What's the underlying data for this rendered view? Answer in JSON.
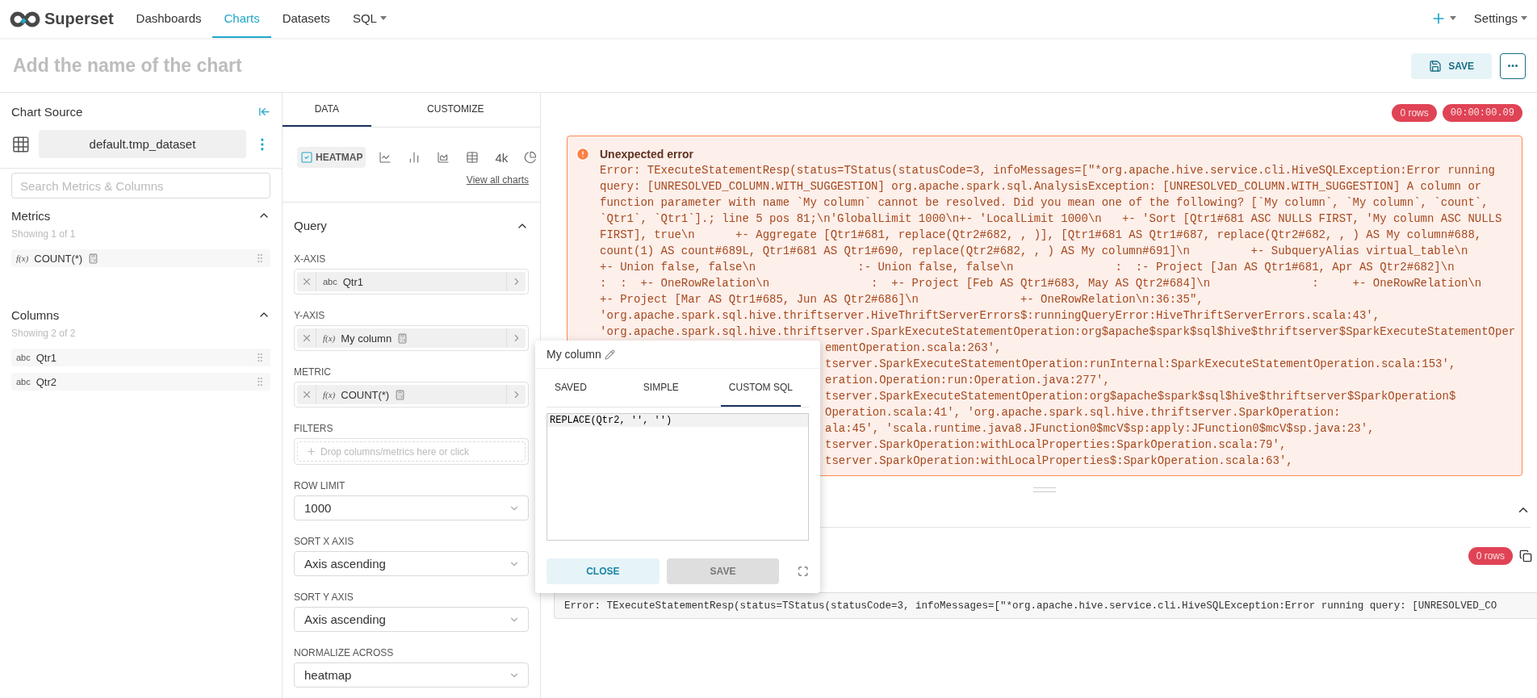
{
  "nav": {
    "logo": "Superset",
    "items": [
      {
        "label": "Dashboards",
        "selected": false,
        "dropdown": false
      },
      {
        "label": "Charts",
        "selected": true,
        "dropdown": false
      },
      {
        "label": "Datasets",
        "selected": false,
        "dropdown": false
      },
      {
        "label": "SQL",
        "selected": false,
        "dropdown": true
      }
    ],
    "settings": {
      "label": "Settings",
      "dropdown": true
    }
  },
  "chart_title": {
    "placeholder": "Add the name of the chart"
  },
  "save_button": {
    "label": "SAVE"
  },
  "chart_source": {
    "title": "Chart Source",
    "dataset": "default.tmp_dataset",
    "search": {
      "placeholder": "Search Metrics & Columns"
    },
    "sections": [
      {
        "title": "Metrics",
        "expanded": true,
        "showing": "Showing 1 of 1",
        "items": [
          {
            "kind": "metric",
            "type_label": "f(x)",
            "label": "COUNT(*)"
          }
        ]
      },
      {
        "title": "Columns",
        "expanded": true,
        "showing": "Showing 2 of 2",
        "items": [
          {
            "kind": "column",
            "type_label": "abc",
            "label": "Qtr1"
          },
          {
            "kind": "column",
            "type_label": "abc",
            "label": "Qtr2"
          }
        ]
      }
    ]
  },
  "tabs": [
    {
      "label": "DATA",
      "selected": true
    },
    {
      "label": "CUSTOMIZE",
      "selected": false
    }
  ],
  "chart_types": [
    {
      "kind": "heatmap",
      "label": "HEATMAP",
      "selected": true
    },
    {
      "kind": "line",
      "selected": false
    },
    {
      "kind": "bar",
      "selected": false
    },
    {
      "kind": "area",
      "selected": false
    },
    {
      "kind": "table",
      "selected": false
    },
    {
      "kind": "number",
      "label": "4k",
      "selected": false
    },
    {
      "kind": "pie",
      "selected": false
    }
  ],
  "view_all": "View all charts",
  "query": {
    "title": "Query",
    "expanded": true,
    "controls": [
      {
        "kind": "pill",
        "label": "X-AXIS",
        "type_label": "abc",
        "value": "Qtr1",
        "saved_metric": false
      },
      {
        "kind": "pill",
        "label": "Y-AXIS",
        "type_label": "f(x)",
        "value": "My column",
        "saved_metric": true
      },
      {
        "kind": "pill",
        "label": "METRIC",
        "type_label": "f(x)",
        "value": "COUNT(*)",
        "saved_metric": true
      },
      {
        "kind": "drop",
        "label": "FILTERS",
        "placeholder": "Drop columns/metrics here or click"
      },
      {
        "kind": "select",
        "label": "ROW LIMIT",
        "value": "1000"
      },
      {
        "kind": "select",
        "label": "SORT X AXIS",
        "value": "Axis ascending"
      },
      {
        "kind": "select",
        "label": "SORT Y AXIS",
        "value": "Axis ascending"
      },
      {
        "kind": "select",
        "label": "NORMALIZE ACROSS",
        "value": "heatmap"
      }
    ]
  },
  "results": {
    "badges": [
      {
        "kind": "rows",
        "text": "0 rows"
      },
      {
        "kind": "time",
        "text": "00:00:00.09"
      }
    ],
    "error": {
      "title": "Unexpected error",
      "lines": [
        {
          "text": "Error: TExecuteStatementResp(status=TStatus(statusCode=3, infoMessages=[\"*org.apache.hive.service.cli.HiveSQLException:Error running",
          "covered": false
        },
        {
          "text": "query: [UNRESOLVED_COLUMN.WITH_SUGGESTION] org.apache.spark.sql.AnalysisException: [UNRESOLVED_COLUMN.WITH_SUGGESTION] A column or",
          "covered": false
        },
        {
          "text": "function parameter with name `My column` cannot be resolved. Did you mean one of the following? [`My column`, `My column`, `count`,",
          "covered": false
        },
        {
          "text": "`Qtr1`, `Qtr1`].; line 5 pos 81;\\n'GlobalLimit 1000\\n+- 'LocalLimit 1000\\n   +- 'Sort [Qtr1#681 ASC NULLS FIRST, 'My column ASC NULLS",
          "covered": false
        },
        {
          "text": "FIRST], true\\n      +- Aggregate [Qtr1#681, replace(Qtr2#682, , )], [Qtr1#681 AS Qtr1#687, replace(Qtr2#682, , ) AS My column#688,",
          "covered": false
        },
        {
          "text": "count(1) AS count#689L, Qtr1#681 AS Qtr1#690, replace(Qtr2#682, , ) AS My column#691]\\n         +- SubqueryAlias virtual_table\\n",
          "covered": false
        },
        {
          "text": "+- Union false, false\\n               :- Union false, false\\n               :  :- Project [Jan AS Qtr1#681, Apr AS Qtr2#682]\\n",
          "covered": false
        },
        {
          "text": ":  :  +- OneRowRelation\\n               :  +- Project [Feb AS Qtr1#683, May AS Qtr2#684]\\n               :     +- OneRowRelation\\n",
          "covered": false
        },
        {
          "text": "+- Project [Mar AS Qtr1#685, Jun AS Qtr2#686]\\n               +- OneRowRelation\\n:36:35\",",
          "covered": false
        },
        {
          "text": "'org.apache.spark.sql.hive.thriftserver.HiveThriftServerErrors$:runningQueryError:HiveThriftServerErrors.scala:43',",
          "covered": false
        },
        {
          "text": "'org.apache.spark.sql.hive.thriftserver.SparkExecuteStatementOperation:org$apache$spark$sql$hive$thriftserver$SparkExecuteStatementOper",
          "covered": false
        },
        {
          "text": "ementOperation.scala:263',",
          "covered": true
        },
        {
          "text": "tserver.SparkExecuteStatementOperation:runInternal:SparkExecuteStatementOperation.scala:153',",
          "covered": true
        },
        {
          "text": "eration.Operation:run:Operation.java:277',",
          "covered": true
        },
        {
          "text": "tserver.SparkExecuteStatementOperation:org$apache$spark$sql$hive$thriftserver$SparkOperation$",
          "covered": true
        },
        {
          "text": "Operation.scala:41', 'org.apache.spark.sql.hive.thriftserver.SparkOperation:",
          "covered": true
        },
        {
          "text": "ala:45', 'scala.runtime.java8.JFunction0$mcV$sp:apply:JFunction0$mcV$sp.java:23',",
          "covered": true
        },
        {
          "text": "tserver.SparkOperation:withLocalProperties:SparkOperation.scala:79',",
          "covered": true
        },
        {
          "text": "tserver.SparkOperation:withLocalProperties$:SparkOperation.scala:63',",
          "covered": true
        }
      ]
    },
    "samples": {
      "expanded": true,
      "badge": "0 rows",
      "error": "Error: TExecuteStatementResp(status=TStatus(statusCode=3, infoMessages=[\"*org.apache.hive.service.cli.HiveSQLException:Error running query: [UNRESOLVED_CO"
    }
  },
  "popover": {
    "title": "My column",
    "tabs": [
      {
        "label": "SAVED",
        "selected": false
      },
      {
        "label": "SIMPLE",
        "selected": false
      },
      {
        "label": "CUSTOM SQL",
        "selected": true
      }
    ],
    "sql": "REPLACE(Qtr2, '', '')",
    "buttons": [
      {
        "kind": "primary",
        "label": "CLOSE"
      },
      {
        "kind": "disabled",
        "label": "SAVE"
      }
    ]
  }
}
